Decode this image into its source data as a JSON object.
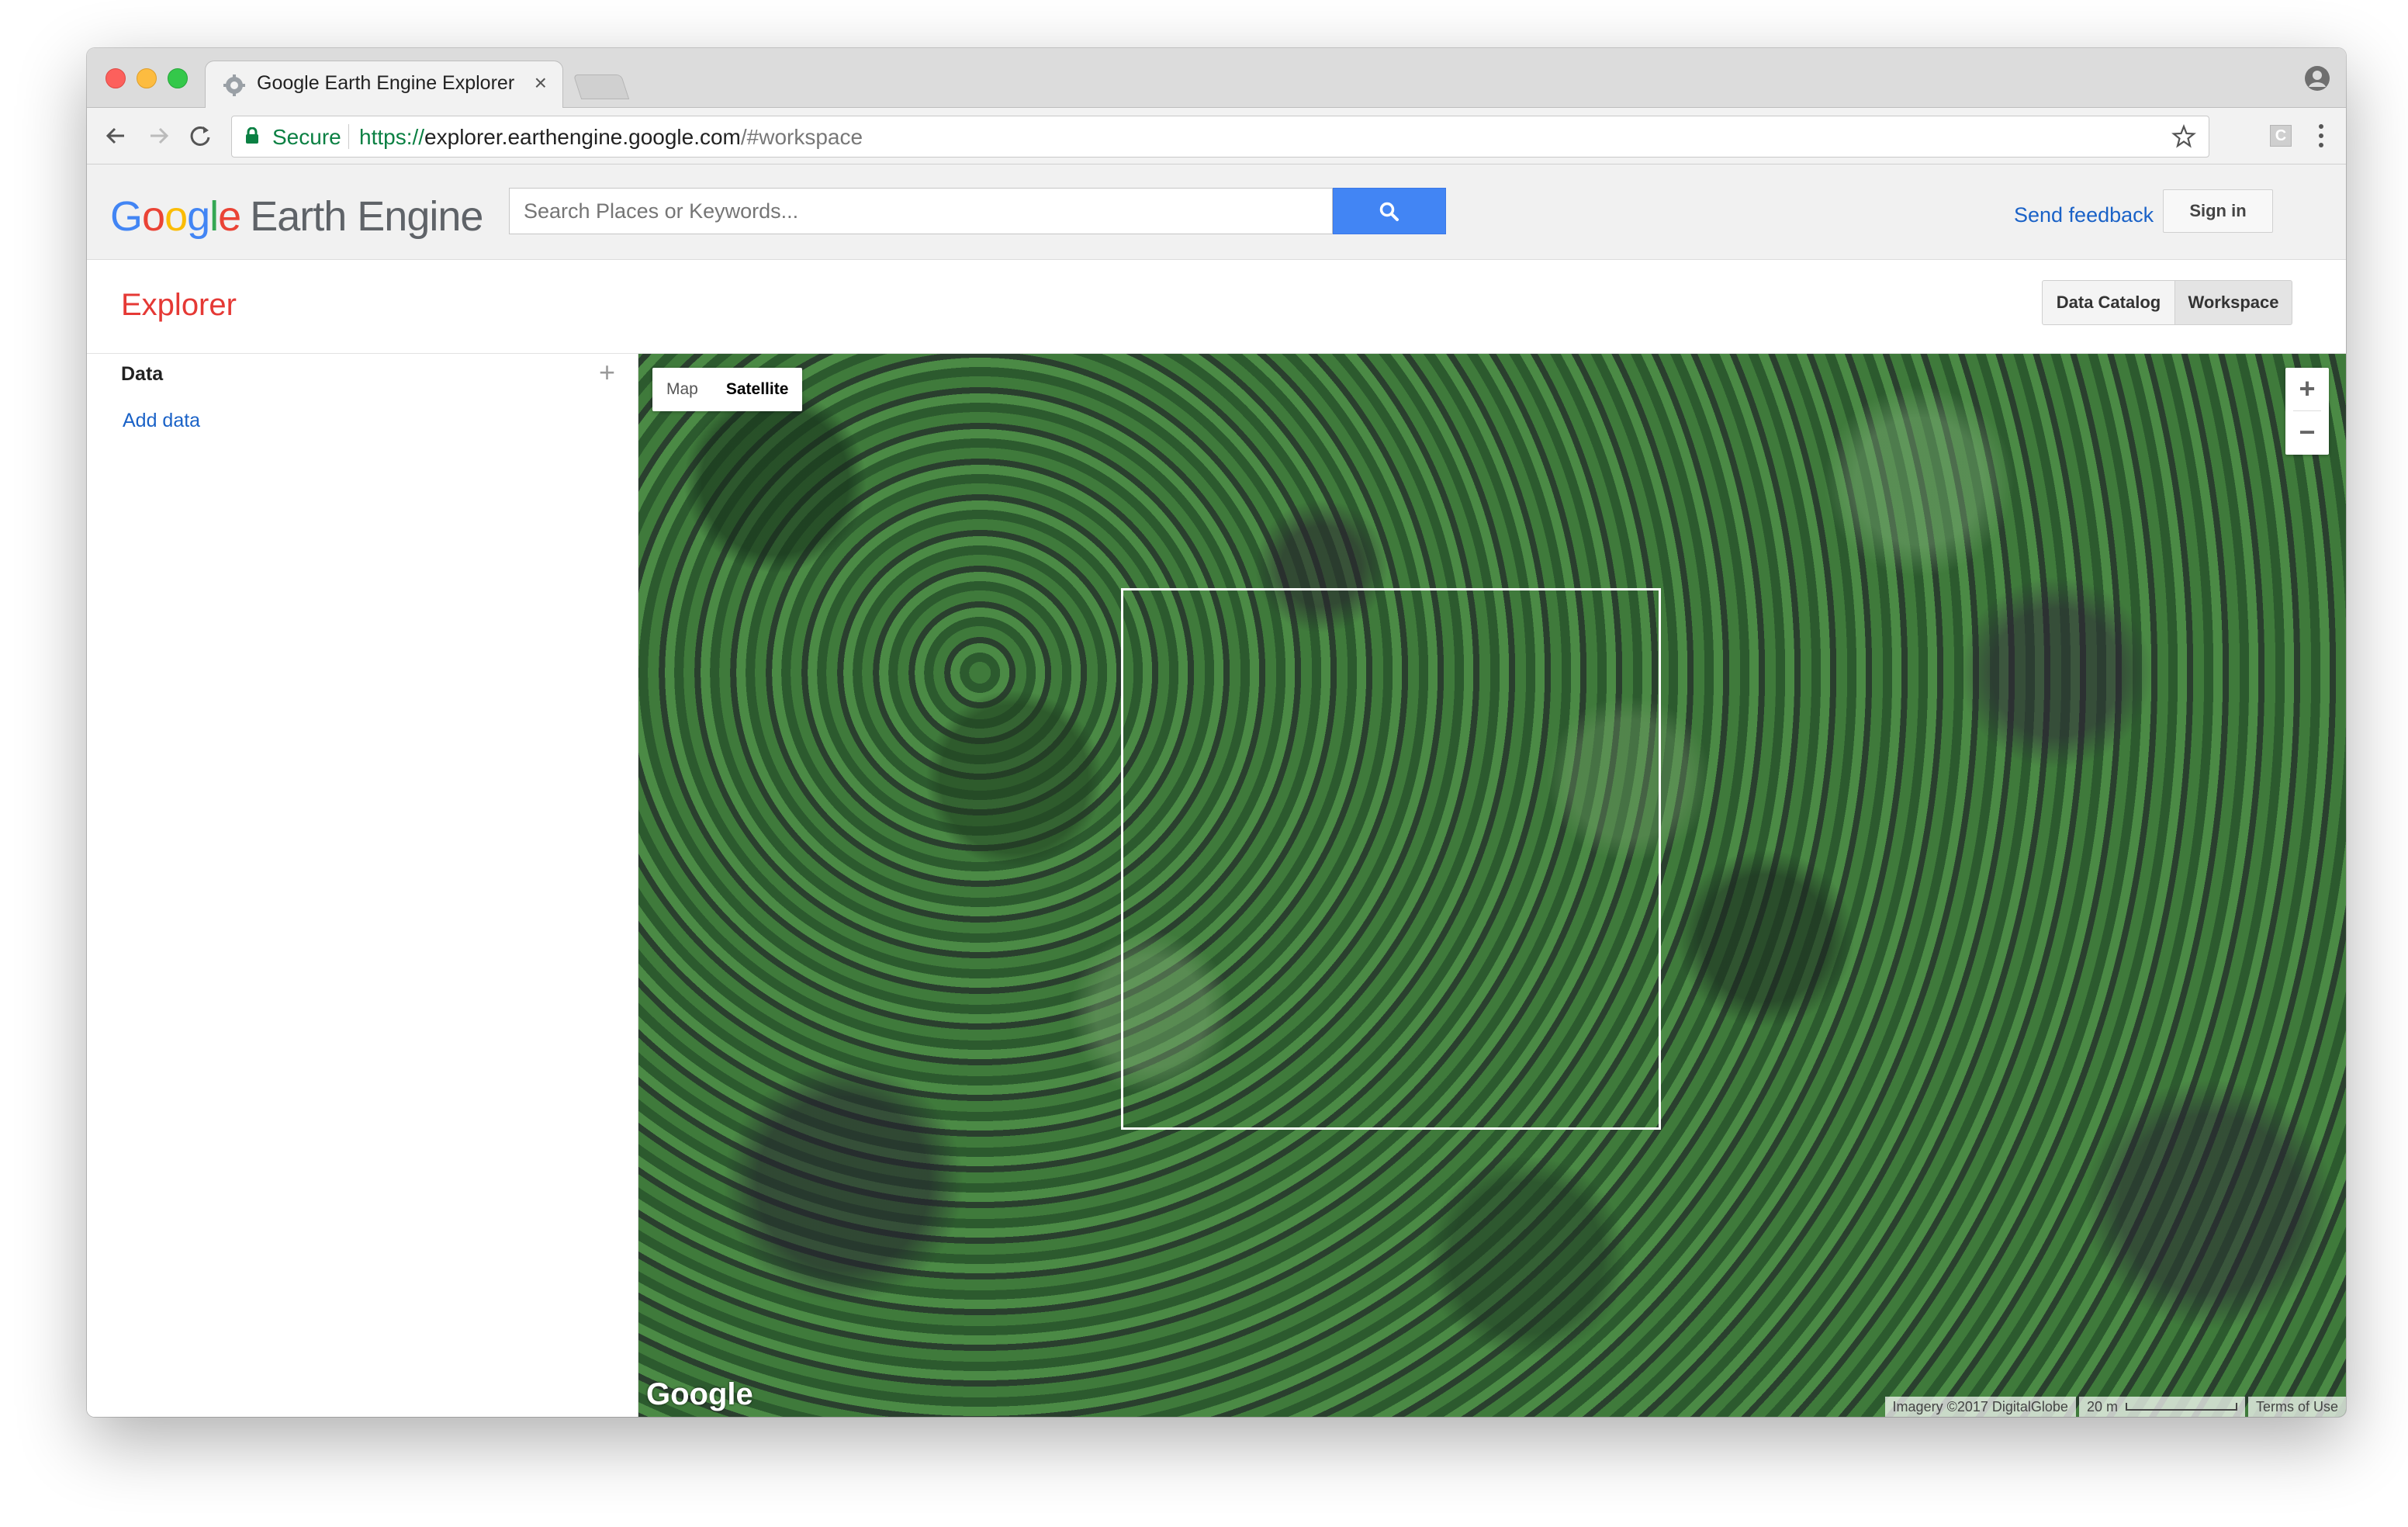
{
  "browser": {
    "tab_title": "Google Earth Engine Explorer",
    "tab_close": "×",
    "secure_label": "Secure",
    "url_scheme": "https://",
    "url_host": "explorer.earthengine.google.com",
    "url_path": "/#workspace",
    "extension_badge": "C"
  },
  "header": {
    "logo_google": [
      "G",
      "o",
      "o",
      "g",
      "l",
      "e"
    ],
    "logo_product": "Earth Engine",
    "search_placeholder": "Search Places or Keywords...",
    "send_feedback": "Send feedback",
    "sign_in": "Sign in"
  },
  "subheader": {
    "title": "Explorer",
    "tabs": [
      "Data Catalog",
      "Workspace"
    ],
    "active_tab": "Workspace"
  },
  "sidebar": {
    "heading": "Data",
    "add_icon": "+",
    "add_link": "Add data"
  },
  "map": {
    "type_options": [
      "Map",
      "Satellite"
    ],
    "selected_type": "Satellite",
    "zoom_in": "+",
    "zoom_out": "−",
    "watermark": "Google",
    "imagery_credit": "Imagery ©2017 DigitalGlobe",
    "scale_label": "20 m",
    "terms": "Terms of Use"
  },
  "colors": {
    "brand_red": "#e53935",
    "link_blue": "#1a62c7",
    "search_blue": "#4285f4",
    "secure_green": "#0b8043"
  }
}
